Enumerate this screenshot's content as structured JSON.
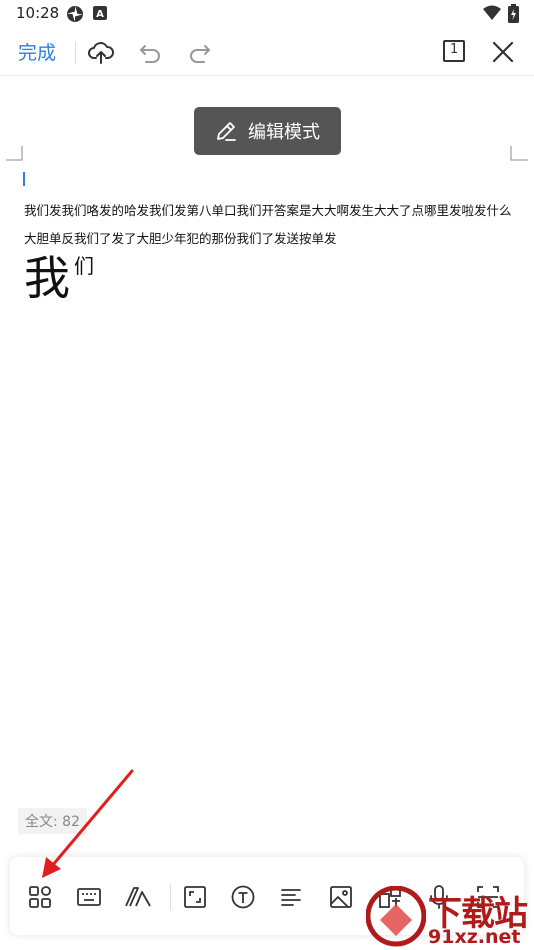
{
  "status_bar": {
    "time": "10:28",
    "icons": [
      "settings-pinwheel-icon",
      "a-letter-icon",
      "wifi-icon",
      "battery-charging-icon"
    ]
  },
  "top_bar": {
    "done_label": "完成",
    "page_number": "1",
    "icons": [
      "cloud-upload-icon",
      "undo-icon",
      "redo-icon",
      "page-count-icon",
      "close-icon"
    ],
    "accent_color": "#2f7ee6"
  },
  "mode_indicator": {
    "label": "编辑模式",
    "icon": "pen-edit-icon"
  },
  "document": {
    "line1": "我们发我们咯发的哈发我们发第八单口我们开答案是大大啊发生大大了点哪里发啦发什么",
    "line2": "大胆单反我们了发了大胆少年犯的那份我们了发送按单发",
    "large_char": "我",
    "superscript_char": "们"
  },
  "word_count": "全文: 82",
  "bottom_toolbar": {
    "icons": [
      "apps-grid-icon",
      "keyboard-icon",
      "text-style-icon",
      "fullscreen-icon",
      "insert-text-icon",
      "align-left-icon",
      "image-icon",
      "shapes-icon",
      "microphone-icon",
      "scan-icon"
    ]
  },
  "watermark": {
    "main": "下载站",
    "sub": "91xz.net"
  },
  "colors": {
    "accent": "#2f7ee6",
    "arrow": "#e02020",
    "watermark": "#b01a1a"
  }
}
